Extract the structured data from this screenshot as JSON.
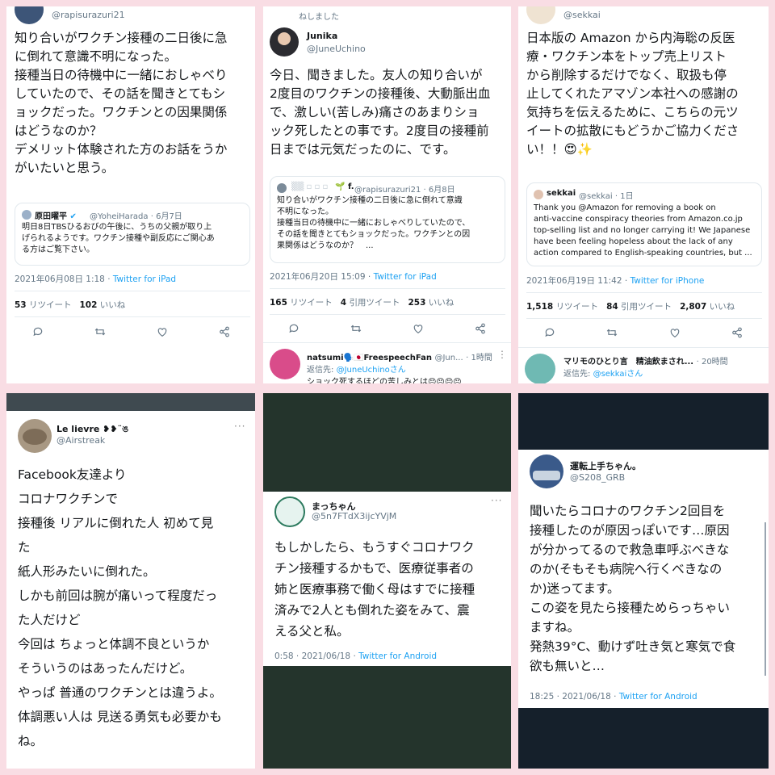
{
  "panels": [
    {
      "handle": "@rapisurazuri21",
      "body": [
        "知り合いがワクチン接種の二日後に急",
        "に倒れて意識不明になった。",
        "接種当日の待機中に一緒におしゃべり",
        "していたので、その話を聞きとてもシ",
        "ョックだった。ワクチンとの因果関係",
        "はどうなのか？",
        "デメリット体験された方のお話をうか",
        "がいたいと思う。"
      ],
      "quote": {
        "name": "原田曜平",
        "handle": "@YoheiHarada",
        "date": "· 6月7日",
        "text": [
          "明日8日TBSひるおびの午後に、うちの父親が取り上",
          "げられるようです。ワクチン接種や副反応にご関心あ",
          "る方はご覧下さい。"
        ]
      },
      "timestamp": "2021年06月08日 1:18 · ",
      "client": "Twitter for iPad",
      "retweets": "53",
      "retweets_label": "リツイート",
      "likes": "102",
      "likes_label": "いいね"
    },
    {
      "top_fragment": "ねしました",
      "name": "Junika",
      "handle": "@JuneUchino",
      "body": [
        "今日、聞きました。友人の知り合いが",
        "2度目のワクチンの接種後、大動脈出血",
        "で、激しい(苦しみ)痛さのあまりショ",
        "ック死したとの事です。2度目の接種前",
        "日までは元気だったのに、です。"
      ],
      "quote": {
        "name": "f.",
        "handle": "@rapisurazuri21",
        "date": "· 6月8日",
        "text": [
          "知り合いがワクチン接種の二日後に急に倒れて意識",
          "不明になった。",
          "接種当日の待機中に一緒におしゃべりしていたので、",
          "その話を聞きとてもショックだった。ワクチンとの因",
          "果関係はどうなのか？　..."
        ]
      },
      "timestamp": "2021年06月20日 15:09 · ",
      "client": "Twitter for iPad",
      "retweets": "165",
      "retweets_label": "リツイート",
      "quotes": "4",
      "quotes_label": "引用ツイート",
      "likes": "253",
      "likes_label": "いいね",
      "reply": {
        "name": "natsumi🗣️🇯🇵FreespeechFan",
        "handle": "@Jun...",
        "time": "· 1時間",
        "replying": "返信先: ",
        "replying_to": "@JuneUchinoさん",
        "text": "ショック死するほどの苦しみとは😣😣😣😣"
      }
    },
    {
      "handle": "@sekkai",
      "body": [
        "日本版の Amazon から内海聡の反医",
        "療・ワクチン本をトップ売上リスト",
        "から削除するだけでなく、取扱も停",
        "止してくれたアマゾン本社への感謝の",
        "気持ちを伝えるために、こちらの元ツ",
        "イートの拡散にもどうかご協力くださ",
        "い！！😍✨"
      ],
      "quote": {
        "name": "sekkai",
        "handle": "@sekkai",
        "date": "· 1日",
        "text": [
          "Thank you @Amazon for removing a book on",
          "anti-vaccine conspiracy theories from Amazon.co.jp",
          "top-selling list and no longer carrying it! We Japanese",
          "have been feeling hopeless about the lack of any",
          "action compared to English-speaking countries, but  ..."
        ]
      },
      "timestamp": "2021年06月19日 11:42 · ",
      "client": "Twitter for iPhone",
      "retweets": "1,518",
      "retweets_label": "リツイート",
      "quotes": "84",
      "quotes_label": "引用ツイート",
      "likes": "2,807",
      "likes_label": "いいね",
      "reply": {
        "name": "マリモのひとり言　精油飲まされ...",
        "time": "· 20時間",
        "replying": "返信先: ",
        "replying_to": "@sekkaiさん"
      }
    },
    {
      "name": "Le lievre ❥❥¨ঙ",
      "handle": "@Airstreak",
      "body": [
        "Facebook友達より",
        "コロナワクチンで",
        "接種後 リアルに倒れた人 初めて見",
        "た",
        "紙人形みたいに倒れた。",
        "しかも前回は腕が痛いって程度だっ",
        "た人だけど",
        "今回は ちょっと体調不良というか",
        "そういうのはあったんだけど。",
        "やっぱ 普通のワクチンとは違うよ。",
        "体調悪い人は 見送る勇気も必要かも",
        "ね。"
      ]
    },
    {
      "name": "まっちゃん",
      "handle": "@5n7FTdX3ijcYVjM",
      "body": [
        "もしかしたら、もうすぐコロナワク",
        "チン接種するかもで、医療従事者の",
        "姉と医療事務で働く母はすでに接種",
        "済みで2人とも倒れた姿をみて、震",
        "える父と私。"
      ],
      "timestamp": "0:58 · 2021/06/18 · ",
      "client": "Twitter for Android"
    },
    {
      "name": "運転上手ちゃん。",
      "handle": "@S208_GRB",
      "body": [
        "聞いたらコロナのワクチン2回目を",
        "接種したのが原因っぽいです…原因",
        "が分かってるので救急車呼ぶべきな",
        "のか(そもそも病院へ行くべきなの",
        "か)迷ってます。",
        "この姿を見たら接種ためらっちゃい",
        "ますね。",
        "発熱39°C、動けず吐き気と寒気で食",
        "欲も無いと…"
      ],
      "timestamp": "18:25 · 2021/06/18 · ",
      "client": "Twitter for Android"
    }
  ],
  "colors": {
    "background": "#f9dde4",
    "link": "#1da1f2",
    "dark": "#15202b"
  }
}
